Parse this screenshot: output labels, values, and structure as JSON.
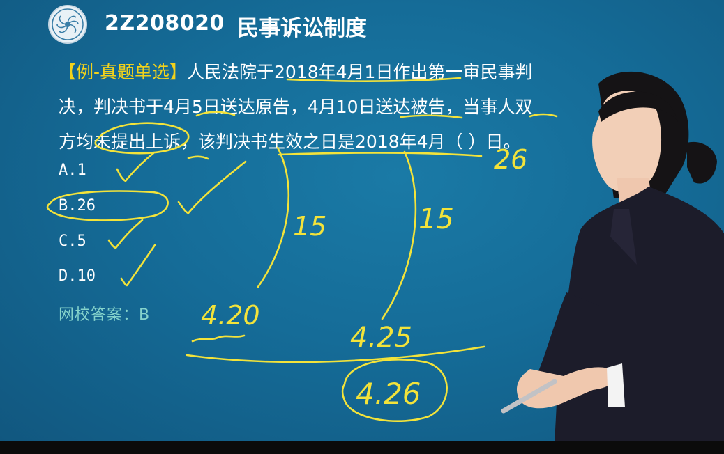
{
  "header": {
    "code": "2Z208020",
    "title": "民事诉讼制度"
  },
  "question": {
    "tag": "【例-真题单选】",
    "line1": "人民法院于2018年4月1日作出第一审民事判",
    "line2": "决，判决书于4月5日送达原告，4月10日送达被告，当事人双",
    "line3": "方均未提出上诉，该判决书生效之日是2018年4月（     ）日。"
  },
  "options": [
    "A.1",
    "B.26",
    "C.5",
    "D.10"
  ],
  "answer": "网校答案：B",
  "annotations": {
    "blank_fill": "26",
    "left_period": "15",
    "right_period": "15",
    "date_plaintiff": "4.20",
    "date_defendant": "4.25",
    "date_effective": "4.26"
  },
  "colors": {
    "background": "#156c98",
    "text": "#ffffff",
    "tag": "#f2d21b",
    "answer": "#86d4cc",
    "ink": "#f3e33a",
    "jacket": "#1c1c2a"
  }
}
